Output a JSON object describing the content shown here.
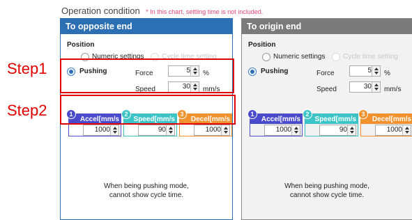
{
  "header": {
    "title": "Operation condition",
    "note": "* In this chart, settling time is not included."
  },
  "steps": {
    "step1": "Step1",
    "step2": "Step2"
  },
  "panels": {
    "opposite": {
      "title": "To opposite end",
      "position_label": "Position",
      "numeric_label": "Numeric settings",
      "cycle_label": "Cycle time setting",
      "pushing_label": "Pushing",
      "force_label": "Force",
      "force_value": "5",
      "force_unit": "%",
      "speed_label": "Speed",
      "speed_value": "30",
      "speed_unit": "mm/s",
      "params": [
        {
          "num": "1",
          "label": "Accel[mm/s",
          "value": "1000"
        },
        {
          "num": "2",
          "label": "Speed[mm/s",
          "value": "90"
        },
        {
          "num": "3",
          "label": "Decel[mm/s",
          "value": "1000"
        }
      ],
      "message_line1": "When being pushing mode,",
      "message_line2": "cannot show cycle time."
    },
    "origin": {
      "title": "To origin end",
      "position_label": "Position",
      "numeric_label": "Numeric settings",
      "cycle_label": "Cycle time setting",
      "pushing_label": "Pushing",
      "force_label": "Force",
      "force_value": "5",
      "force_unit": "%",
      "speed_label": "Speed",
      "speed_value": "30",
      "speed_unit": "mm/s",
      "params": [
        {
          "num": "1",
          "label": "Accel[mm/s",
          "value": "1000"
        },
        {
          "num": "2",
          "label": "Speed[mm/s",
          "value": "90"
        },
        {
          "num": "3",
          "label": "Decel[mm/s",
          "value": "1000"
        }
      ],
      "message_line1": "When being pushing mode,",
      "message_line2": "cannot show cycle time."
    }
  },
  "colors": {
    "opposite_header": "#2d6fb3",
    "origin_header": "#7a7a7a",
    "accel": "#4a4acc",
    "speed": "#3cc4c8",
    "decel": "#f2922e",
    "highlight": "#e00000",
    "note": "#e0457a"
  }
}
